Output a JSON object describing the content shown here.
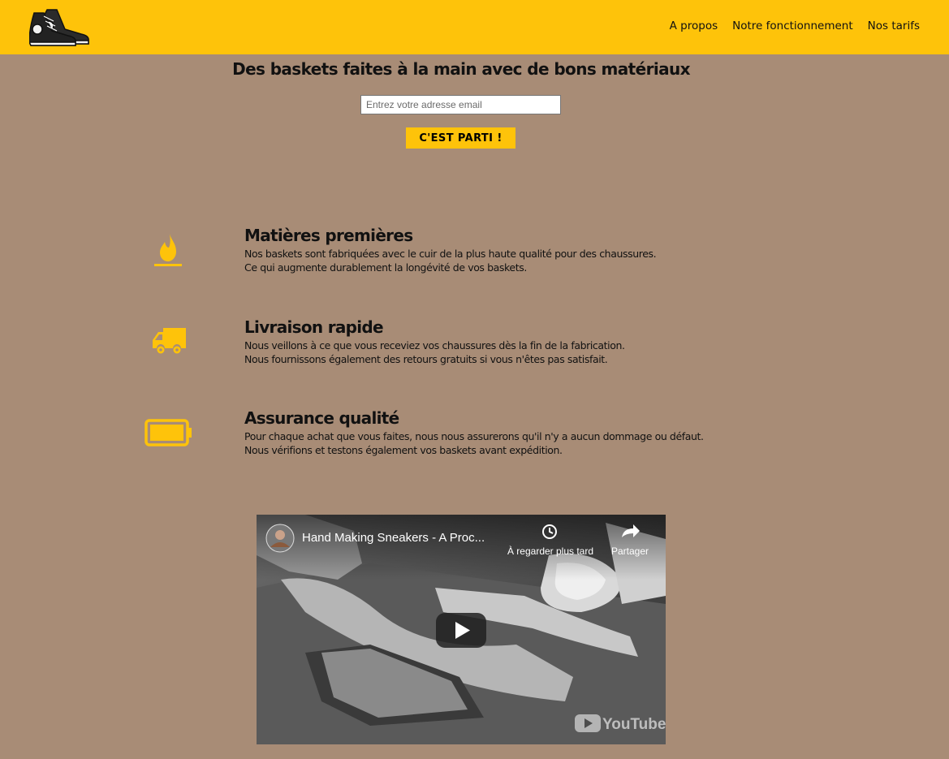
{
  "header": {
    "nav": [
      "A propos",
      "Notre fonctionnement",
      "Nos tarifs"
    ]
  },
  "hero": {
    "title": "Des baskets faites à la main avec de bons matériaux",
    "email_placeholder": "Entrez votre adresse email",
    "cta_label": "C'EST PARTI !"
  },
  "features": [
    {
      "icon": "flame-icon",
      "title": "Matières premières",
      "lines": [
        "Nos baskets sont fabriquées avec le cuir de la plus haute qualité pour des chaussures.",
        "Ce qui augmente durablement la longévité de vos baskets."
      ]
    },
    {
      "icon": "truck-icon",
      "title": "Livraison rapide",
      "lines": [
        "Nous veillons à ce que vous receviez vos chaussures dès la fin de la fabrication.",
        "Nous fournissons également des retours gratuits si vous n'êtes pas satisfait."
      ]
    },
    {
      "icon": "battery-full-icon",
      "title": "Assurance qualité",
      "lines": [
        "Pour chaque achat que vous faites, nous nous assurerons qu'il n'y a aucun dommage ou défaut.",
        "Nous vérifions et testons également vos baskets avant expédition."
      ]
    }
  ],
  "video": {
    "title": "Hand Making Sneakers - A Proc...",
    "watch_later": "À regarder plus tard",
    "share": "Partager",
    "brand": "YouTube"
  },
  "colors": {
    "accent": "#fec30a",
    "background": "#a88c76"
  }
}
